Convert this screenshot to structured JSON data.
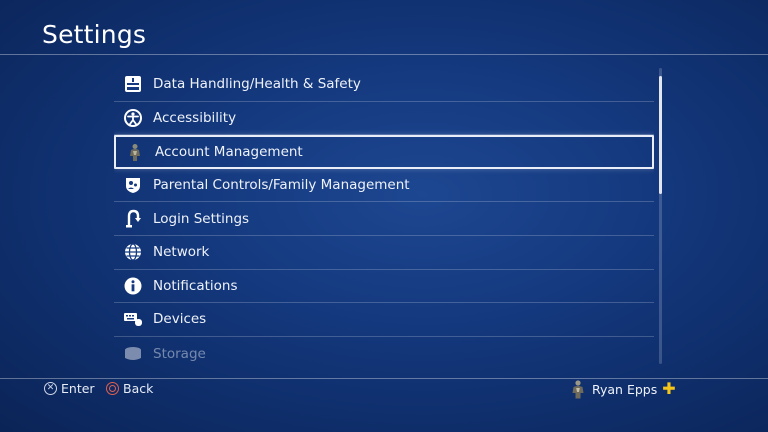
{
  "header": {
    "title": "Settings"
  },
  "menu": {
    "items": [
      {
        "label": "Data Handling/Health & Safety",
        "icon": "info-panel-icon"
      },
      {
        "label": "Accessibility",
        "icon": "accessibility-icon"
      },
      {
        "label": "Account Management",
        "icon": "user-avatar-icon",
        "selected": true
      },
      {
        "label": "Parental Controls/Family Management",
        "icon": "parental-controls-icon"
      },
      {
        "label": "Login Settings",
        "icon": "login-icon"
      },
      {
        "label": "Network",
        "icon": "globe-icon"
      },
      {
        "label": "Notifications",
        "icon": "info-icon"
      },
      {
        "label": "Devices",
        "icon": "keyboard-mouse-icon"
      },
      {
        "label": "Storage",
        "icon": "storage-icon"
      }
    ]
  },
  "footer": {
    "enter_label": "Enter",
    "back_label": "Back",
    "user_name": "Ryan Epps",
    "plus_symbol": "✚"
  },
  "colors": {
    "background": "#153a80",
    "plus": "#f5c518",
    "back_button": "#e0604f"
  }
}
